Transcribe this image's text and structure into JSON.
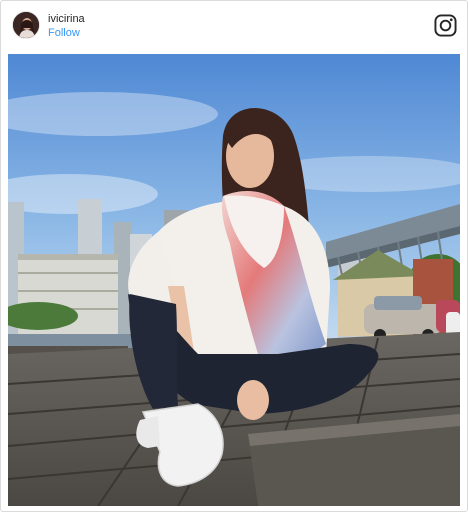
{
  "post": {
    "username": "ivicirina",
    "follow_label": "Follow"
  },
  "icons": {
    "avatar": "avatar",
    "brand": "instagram-icon"
  },
  "colors": {
    "follow_link": "#3897f0",
    "username_text": "#262626",
    "card_border": "#dbdbdb"
  }
}
